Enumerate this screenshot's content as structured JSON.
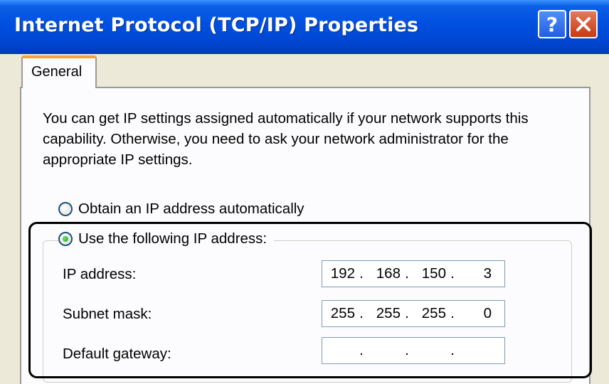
{
  "window": {
    "title": "Internet Protocol (TCP/IP) Properties",
    "help_label": "?"
  },
  "tabs": [
    {
      "label": "General",
      "selected": true
    }
  ],
  "general": {
    "description": "You can get IP settings assigned automatically if your network supports this capability. Otherwise, you need to ask your network administrator for the appropriate IP settings.",
    "radio_auto": {
      "label": "Obtain an IP address automatically",
      "checked": false
    },
    "radio_manual": {
      "label": "Use the following IP address:",
      "checked": true
    },
    "fields": {
      "ip_address": {
        "label": "IP address:",
        "octets": [
          "192",
          "168",
          "150",
          "3"
        ]
      },
      "subnet_mask": {
        "label": "Subnet mask:",
        "octets": [
          "255",
          "255",
          "255",
          "0"
        ]
      },
      "default_gateway": {
        "label": "Default gateway:",
        "octets": [
          "",
          "",
          "",
          ""
        ]
      }
    },
    "separator": "."
  },
  "colors": {
    "title_bar": "#0050e0",
    "highlight_border": "#000000"
  }
}
